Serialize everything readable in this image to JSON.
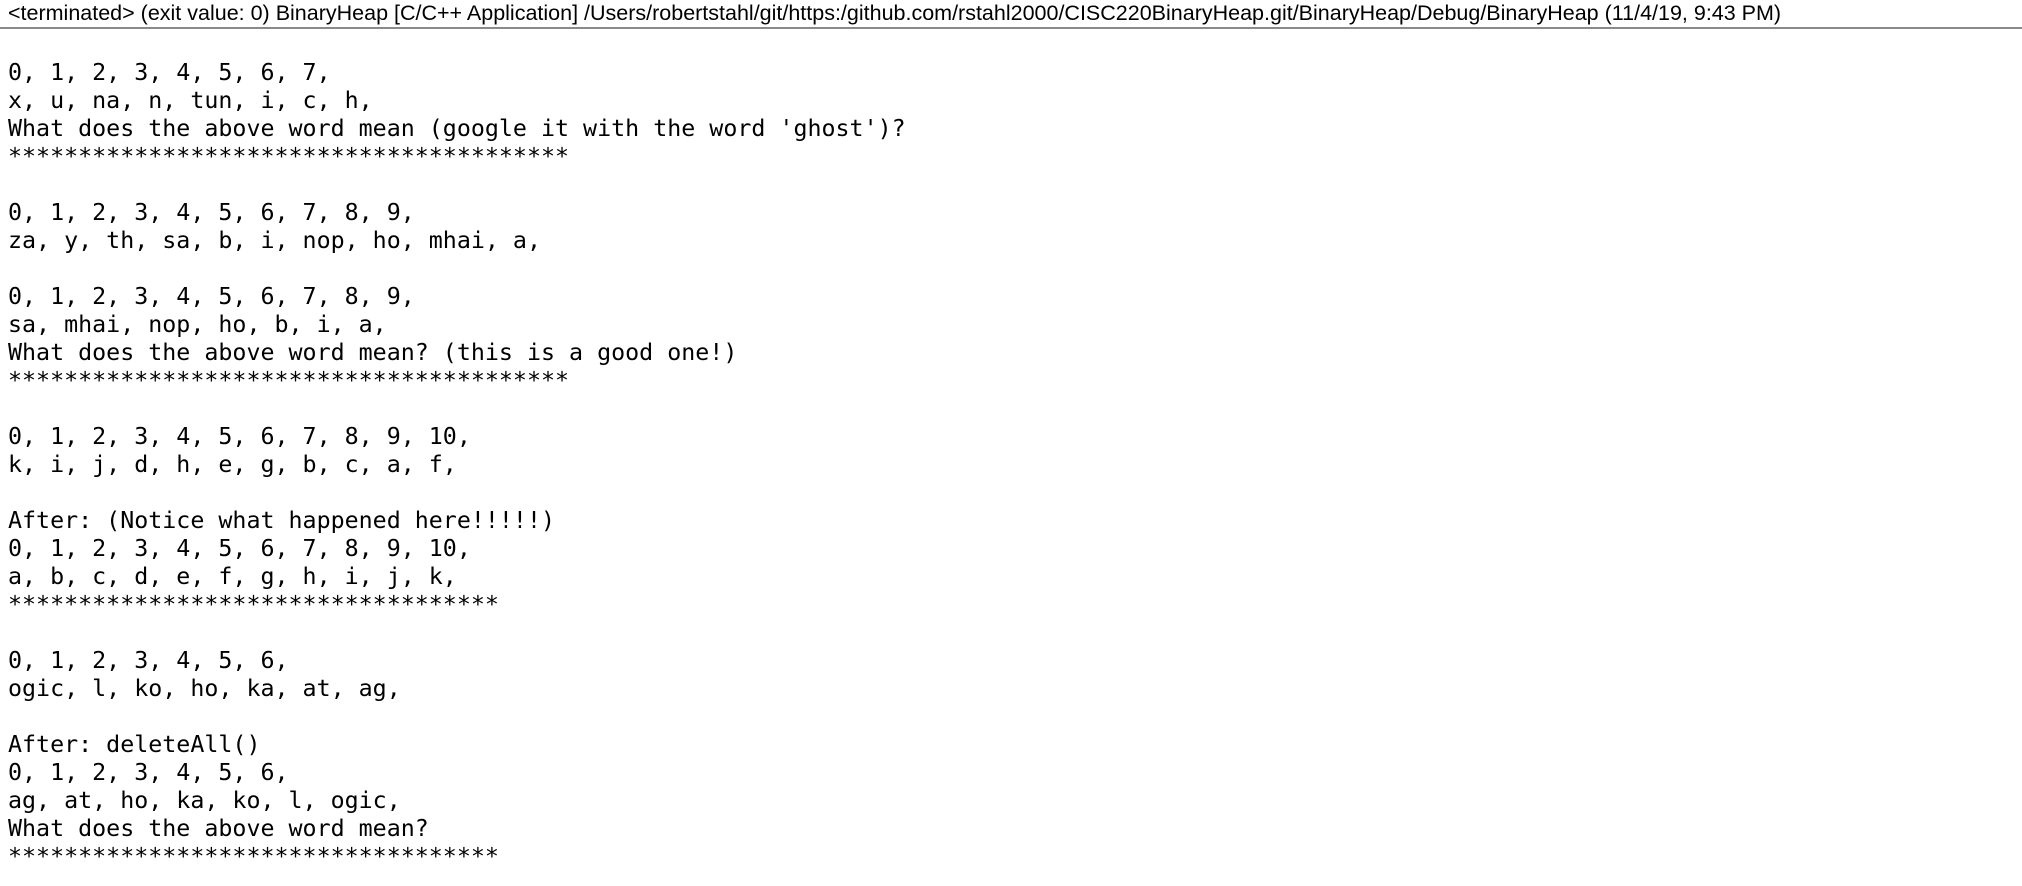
{
  "console": {
    "header": "<terminated> (exit value: 0) BinaryHeap [C/C++ Application] /Users/robertstahl/git/https:/github.com/rstahl2000/CISC220BinaryHeap.git/BinaryHeap/Debug/BinaryHeap (11/4/19, 9:43 PM)",
    "lines": [
      "0, 1, 2, 3, 4, 5, 6, 7,",
      "x, u, na, n, tun, i, c, h,",
      "What does the above word mean (google it with the word 'ghost')?",
      "****************************************",
      "",
      "0, 1, 2, 3, 4, 5, 6, 7, 8, 9,",
      "za, y, th, sa, b, i, nop, ho, mhai, a,",
      "",
      "0, 1, 2, 3, 4, 5, 6, 7, 8, 9,",
      "sa, mhai, nop, ho, b, i, a,",
      "What does the above word mean? (this is a good one!)",
      "****************************************",
      "",
      "0, 1, 2, 3, 4, 5, 6, 7, 8, 9, 10,",
      "k, i, j, d, h, e, g, b, c, a, f,",
      "",
      "After: (Notice what happened here!!!!!)",
      "0, 1, 2, 3, 4, 5, 6, 7, 8, 9, 10,",
      "a, b, c, d, e, f, g, h, i, j, k,",
      "***********************************",
      "",
      "0, 1, 2, 3, 4, 5, 6,",
      "ogic, l, ko, ho, ka, at, ag,",
      "",
      "After: deleteAll()",
      "0, 1, 2, 3, 4, 5, 6,",
      "ag, at, ho, ka, ko, l, ogic,",
      "What does the above word mean?",
      "***********************************"
    ]
  }
}
